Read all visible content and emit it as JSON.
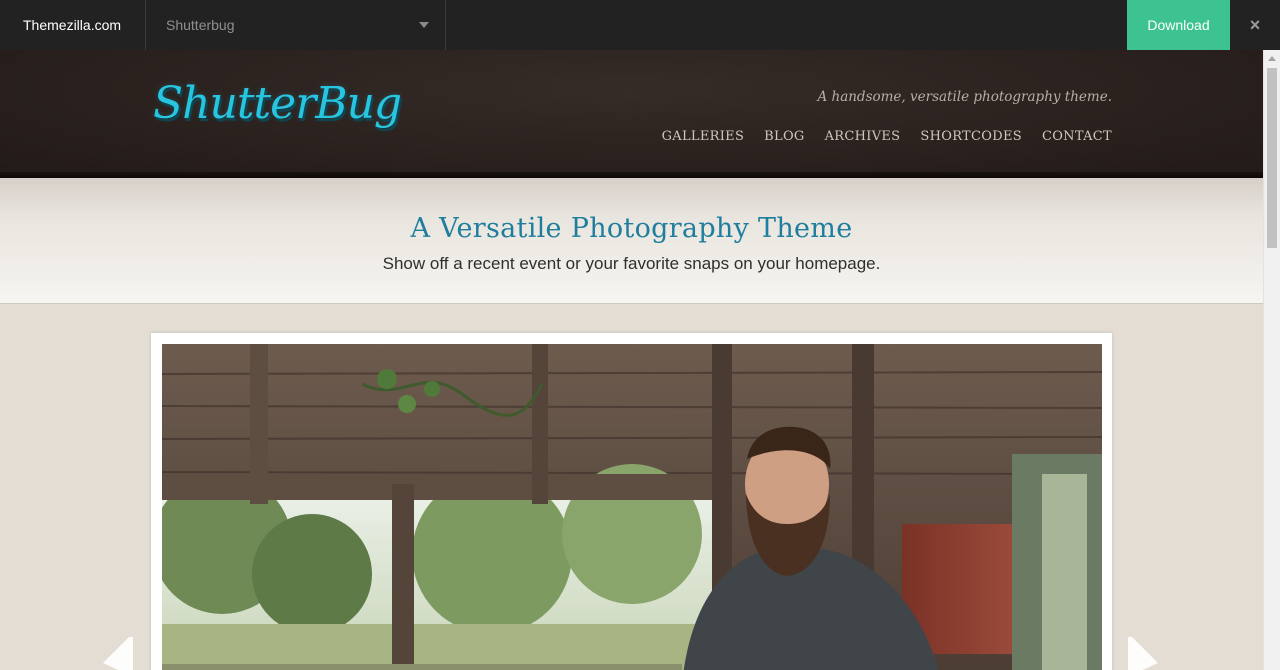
{
  "demo_bar": {
    "site_name": "Themezilla.com",
    "theme_select": "Shutterbug",
    "download_label": "Download",
    "close_icon": "×",
    "colors": {
      "bar": "#222222",
      "download": "#3cc38f"
    }
  },
  "header": {
    "logo_text": "ShutterBug",
    "tagline": "A handsome, versatile photography theme.",
    "nav": [
      {
        "label": "GALLERIES"
      },
      {
        "label": "BLOG"
      },
      {
        "label": "ARCHIVES"
      },
      {
        "label": "SHORTCODES"
      },
      {
        "label": "CONTACT"
      }
    ],
    "colors": {
      "logo": "#28c5e0"
    }
  },
  "intro": {
    "title": "A Versatile Photography Theme",
    "subtitle": "Show off a recent event or your favorite snaps on your homepage.",
    "colors": {
      "title": "#1f7e9d"
    }
  },
  "slider": {
    "prev_icon": "chevron-left-icon",
    "next_icon": "chevron-right-icon"
  }
}
